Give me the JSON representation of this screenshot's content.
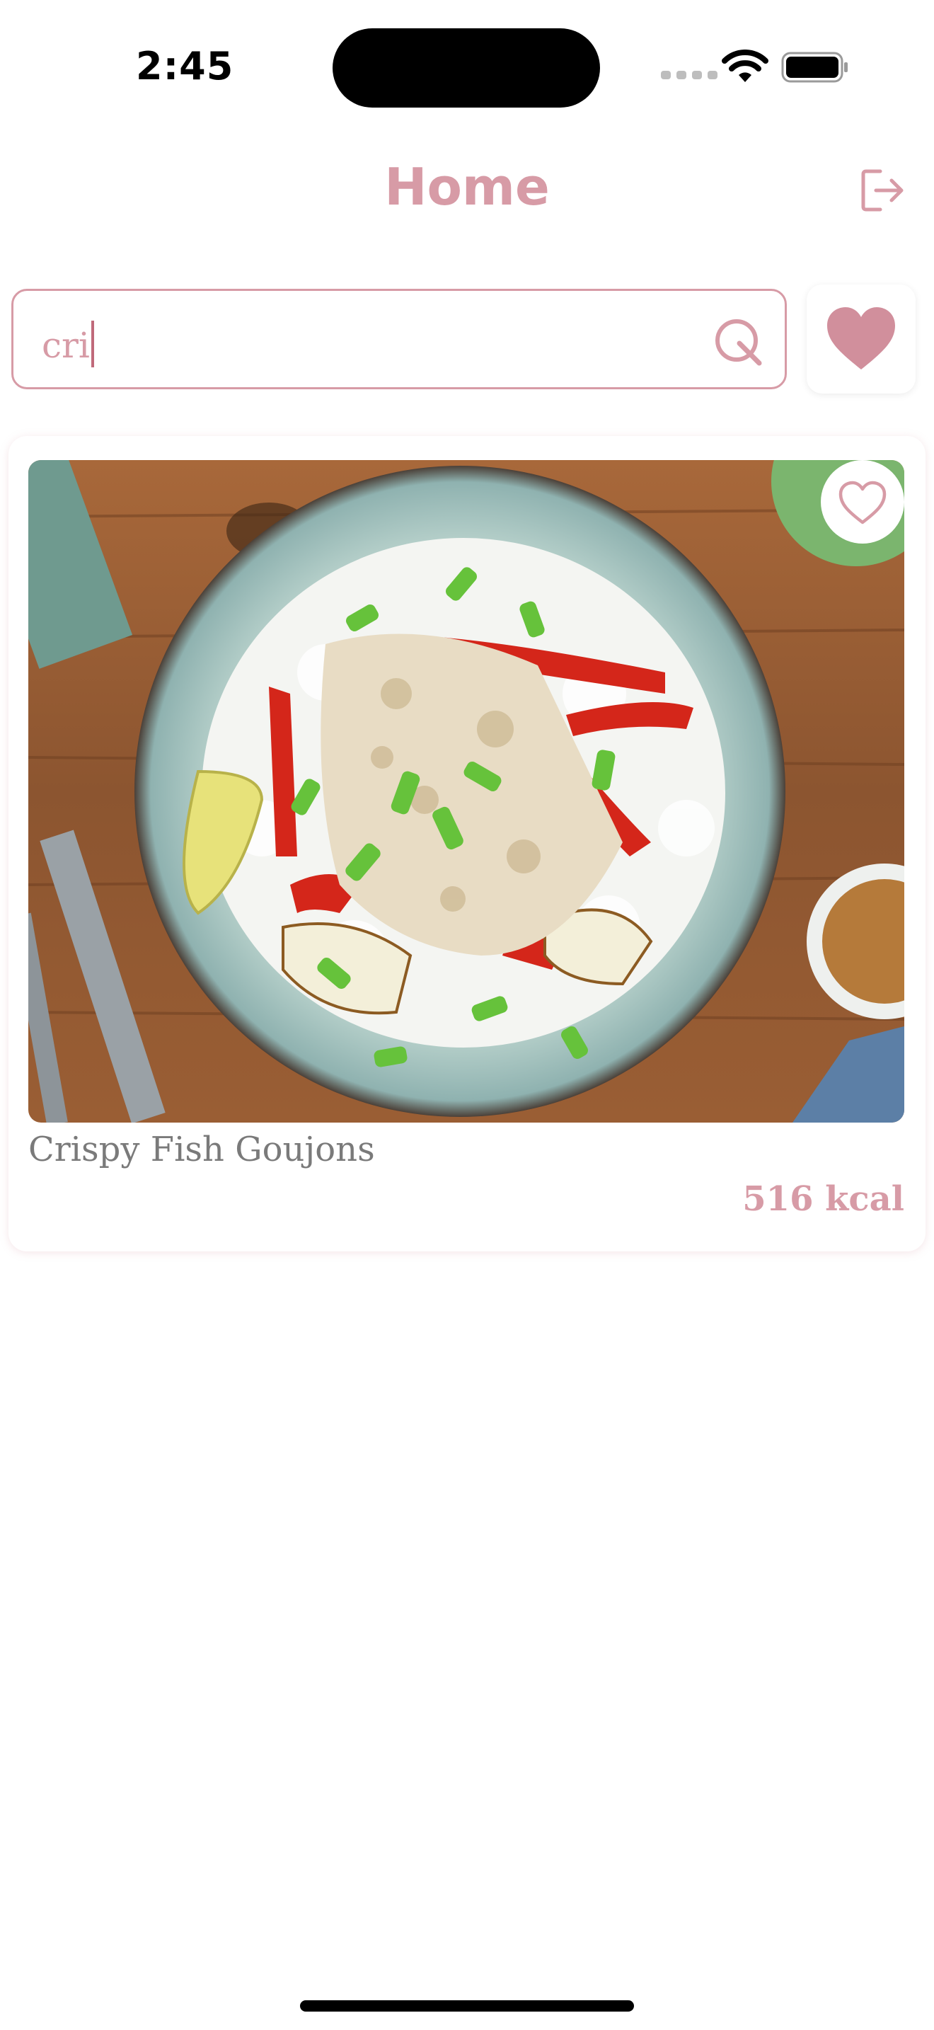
{
  "status_bar": {
    "time": "2:45"
  },
  "header": {
    "title": "Home",
    "logout_icon": "logout-icon"
  },
  "search": {
    "value": "cri",
    "icon": "search-icon"
  },
  "favorites_button": {
    "icon": "heart-filled-icon"
  },
  "results": [
    {
      "name": "Crispy Fish Goujons",
      "kcal": "516 kcal",
      "favorite_icon": "heart-outline-icon"
    }
  ],
  "colors": {
    "accent": "#d79ba6",
    "text_muted": "#7a7a7a",
    "background": "#ffffff"
  }
}
